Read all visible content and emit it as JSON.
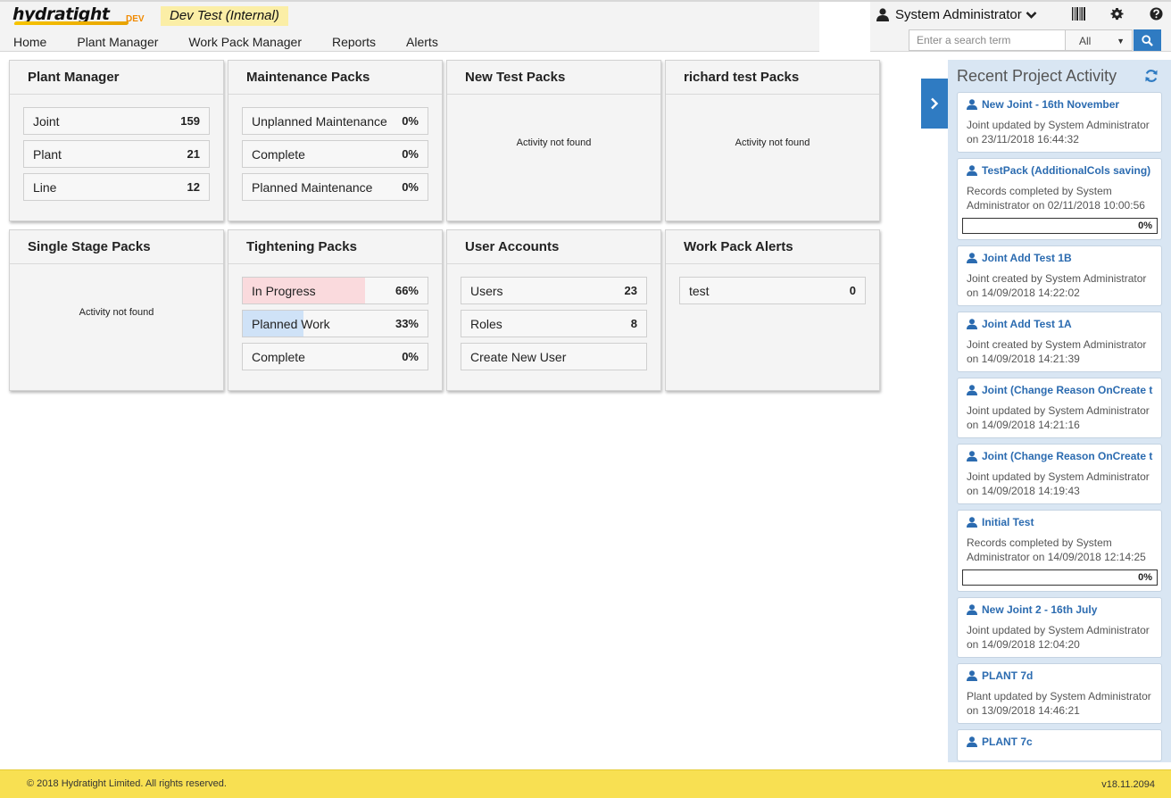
{
  "brand": {
    "logo": "hydratight",
    "logo_suffix": "DEV",
    "environment": "Dev Test (Internal)"
  },
  "nav": [
    "Home",
    "Plant Manager",
    "Work Pack Manager",
    "Reports",
    "Alerts"
  ],
  "user": {
    "name": "System Administrator"
  },
  "icons": {
    "user": "user-icon",
    "barcode": "barcode-icon",
    "settings": "gear-icon",
    "help": "question-circle-icon",
    "search": "search-icon",
    "refresh": "refresh-icon",
    "chevron": "chevron-right-icon"
  },
  "search": {
    "placeholder": "Enter a search term",
    "scope": "All"
  },
  "tiles": [
    {
      "title": "Plant Manager",
      "rows": [
        {
          "label": "Joint",
          "value": "159"
        },
        {
          "label": "Plant",
          "value": "21"
        },
        {
          "label": "Line",
          "value": "12"
        }
      ]
    },
    {
      "title": "Maintenance Packs",
      "rows": [
        {
          "label": "Unplanned Maintenance",
          "value": "0%"
        },
        {
          "label": "Complete",
          "value": "0%"
        },
        {
          "label": "Planned Maintenance",
          "value": "0%"
        }
      ]
    },
    {
      "title": "New Test Packs",
      "empty": "Activity not found"
    },
    {
      "title": "richard test Packs",
      "empty": "Activity not found"
    },
    {
      "title": "Single Stage Packs",
      "empty": "Activity not found"
    },
    {
      "title": "Tightening Packs",
      "rows": [
        {
          "label": "In Progress",
          "value": "66%",
          "progress": 0.66,
          "color": "#fadadd"
        },
        {
          "label": "Planned Work",
          "value": "33%",
          "progress": 0.33,
          "color": "#cfe2f7"
        },
        {
          "label": "Complete",
          "value": "0%"
        }
      ]
    },
    {
      "title": "User Accounts",
      "rows": [
        {
          "label": "Users",
          "value": "23"
        },
        {
          "label": "Roles",
          "value": "8"
        },
        {
          "label": "Create New User",
          "value": ""
        }
      ]
    },
    {
      "title": "Work Pack Alerts",
      "rows": [
        {
          "label": "test",
          "value": "0"
        }
      ]
    }
  ],
  "activity": {
    "title": "Recent Project Activity",
    "items": [
      {
        "title": "New Joint - 16th November",
        "desc": "Joint updated by System Administrator on 23/11/2018 16:44:32"
      },
      {
        "title": "TestPack (AdditionalCols saving)",
        "desc": "Records completed by System Administrator on 02/11/2018 10:00:56",
        "progress": "0%"
      },
      {
        "title": "Joint Add Test 1B",
        "desc": "Joint created by System Administrator on 14/09/2018 14:22:02"
      },
      {
        "title": "Joint Add Test 1A",
        "desc": "Joint created by System Administrator on 14/09/2018 14:21:39"
      },
      {
        "title": "Joint (Change Reason OnCreate t",
        "desc": "Joint updated by System Administrator on 14/09/2018 14:21:16"
      },
      {
        "title": "Joint (Change Reason OnCreate t",
        "desc": "Joint updated by System Administrator on 14/09/2018 14:19:43"
      },
      {
        "title": "Initial Test",
        "desc": "Records completed by System Administrator on 14/09/2018 12:14:25",
        "progress": "0%"
      },
      {
        "title": "New Joint 2 - 16th July",
        "desc": "Joint updated by System Administrator on 14/09/2018 12:04:20"
      },
      {
        "title": "PLANT 7d",
        "desc": "Plant updated by System Administrator on 13/09/2018 14:46:21"
      },
      {
        "title": "PLANT 7c",
        "desc": ""
      }
    ]
  },
  "footer": {
    "copyright": "© 2018 Hydratight Limited. All rights reserved.",
    "version": "v18.11.2094"
  },
  "colors": {
    "accent": "#2f7bc2",
    "footer": "#f8e052",
    "panel": "#d9e6f3",
    "env_badge": "#fbeea6",
    "link": "#2b6bb0"
  }
}
